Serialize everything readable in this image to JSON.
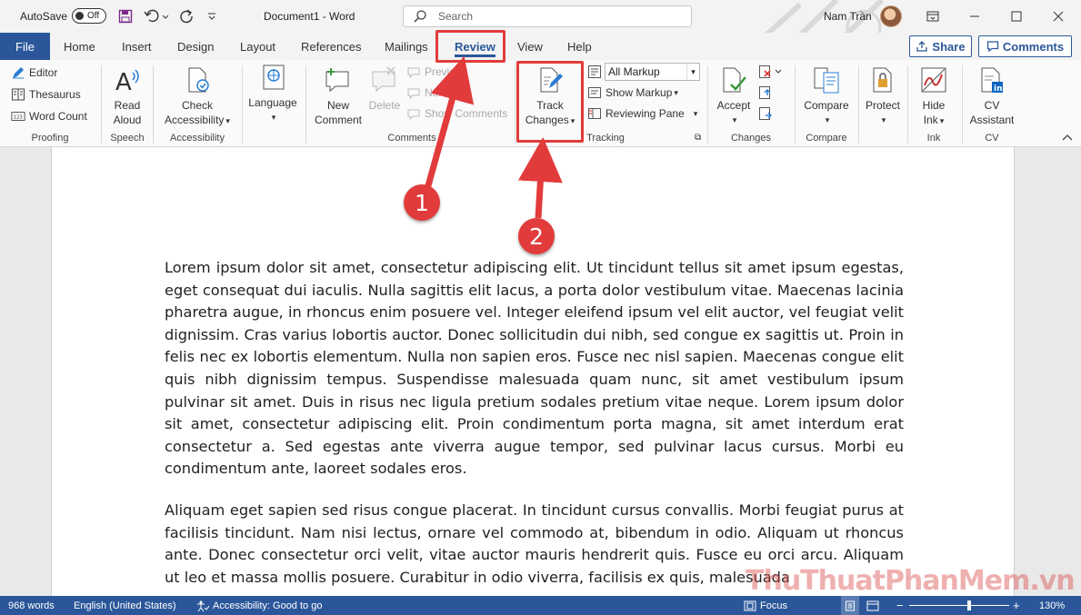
{
  "titlebar": {
    "autosave_label": "AutoSave",
    "autosave_state": "Off",
    "doc_title": "Document1  -  Word",
    "search_placeholder": "Search",
    "user_name": "Nam Trần"
  },
  "tabs": {
    "file": "File",
    "items": [
      "Home",
      "Insert",
      "Design",
      "Layout",
      "References",
      "Mailings",
      "Review",
      "View",
      "Help"
    ],
    "active": "Review",
    "share": "Share",
    "comments": "Comments"
  },
  "ribbon": {
    "proofing": {
      "editor": "Editor",
      "thesaurus": "Thesaurus",
      "word_count": "Word Count",
      "label": "Proofing"
    },
    "speech": {
      "read_aloud_1": "Read",
      "read_aloud_2": "Aloud",
      "label": "Speech"
    },
    "accessibility": {
      "check_1": "Check",
      "check_2": "Accessibility",
      "label": "Accessibility"
    },
    "language": {
      "language": "Language",
      "label": ""
    },
    "comments": {
      "new_1": "New",
      "new_2": "Comment",
      "delete": "Delete",
      "previous": "Previous",
      "next": "Next",
      "show": "Show Comments",
      "label": "Comments"
    },
    "tracking": {
      "track_1": "Track",
      "track_2": "Changes",
      "markup_value": "All Markup",
      "show_markup": "Show Markup",
      "reviewing_pane": "Reviewing Pane",
      "label": "Tracking"
    },
    "changes": {
      "accept": "Accept",
      "label": "Changes"
    },
    "compare": {
      "compare": "Compare",
      "label": "Compare"
    },
    "protect": {
      "protect": "Protect",
      "label": ""
    },
    "ink": {
      "hide_1": "Hide",
      "hide_2": "Ink",
      "label": "Ink"
    },
    "cv": {
      "cv_1": "CV",
      "cv_2": "Assistant",
      "label": "CV"
    }
  },
  "document": {
    "paragraph_1": "Lorem ipsum dolor sit amet, consectetur adipiscing elit. Ut tincidunt tellus sit amet ipsum egestas, eget consequat dui iaculis. Nulla sagittis elit lacus, a porta dolor vestibulum vitae. Maecenas lacinia pharetra augue, in rhoncus enim posuere vel. Integer eleifend ipsum vel elit auctor, vel feugiat velit dignissim. Cras varius lobortis auctor. Donec sollicitudin dui nibh, sed congue ex sagittis ut. Proin in felis nec ex lobortis elementum. Nulla non sapien eros. Fusce nec nisl sapien. Maecenas congue elit quis nibh dignissim tempus. Suspendisse malesuada quam nunc, sit amet vestibulum ipsum pulvinar sit amet. Duis in risus nec ligula pretium sodales pretium vitae neque. Lorem ipsum dolor sit amet, consectetur adipiscing elit. Proin condimentum porta magna, sit amet interdum erat consectetur a. Sed egestas ante viverra augue tempor, sed pulvinar lacus cursus. Morbi eu condimentum ante, laoreet sodales eros.",
    "paragraph_2": "Aliquam eget sapien sed risus congue placerat. In tincidunt cursus convallis. Morbi feugiat purus at facilisis tincidunt. Nam nisi lectus, ornare vel commodo at, bibendum in odio. Aliquam ut rhoncus ante. Donec consectetur orci velit, vitae auctor mauris hendrerit quis. Fusce eu orci arcu. Aliquam ut leo et massa mollis posuere. Curabitur in odio viverra, facilisis ex quis, malesuada"
  },
  "annotations": {
    "step_1": "1",
    "step_2": "2",
    "color": "#e23b3b"
  },
  "watermark": "ThuThuatPhanMem.vn",
  "statusbar": {
    "word_count": "968 words",
    "language": "English (United States)",
    "accessibility": "Accessibility: Good to go",
    "focus": "Focus",
    "zoom": "130%",
    "zoom_level": 0.6
  },
  "colors": {
    "brand": "#2b579a",
    "highlight": "#e23b3b"
  }
}
